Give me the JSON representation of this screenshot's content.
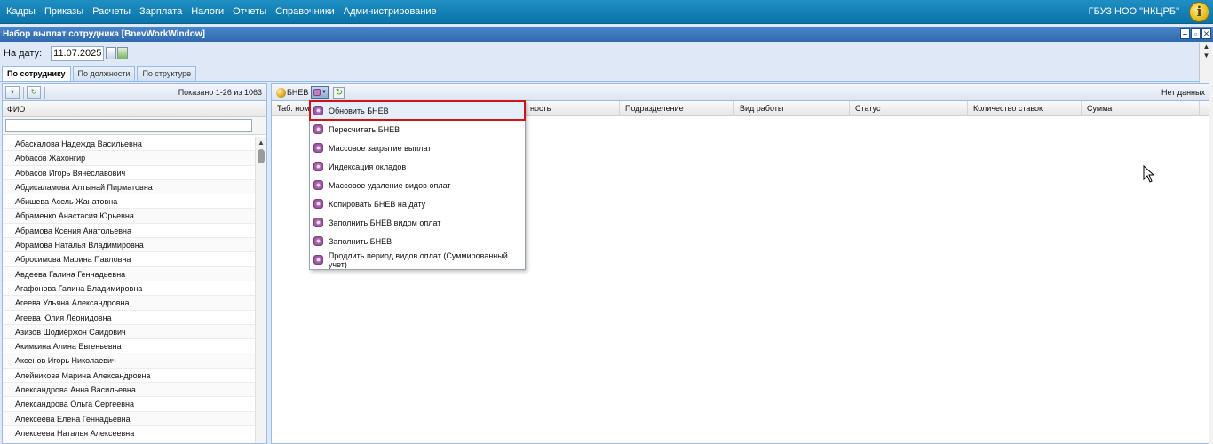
{
  "topbar": {
    "menu": [
      "Кадры",
      "Приказы",
      "Расчеты",
      "Зарплата",
      "Налоги",
      "Отчеты",
      "Справочники",
      "Администрирование"
    ],
    "org": "ГБУЗ НОО \"НКЦРБ\"",
    "info_glyph": "i"
  },
  "window": {
    "title": "Набор выплат сотрудника [BnevWorkWindow]",
    "buttons": [
      "–",
      "▫",
      "✕"
    ]
  },
  "date": {
    "label": "На дату:",
    "value": "11.07.2025"
  },
  "tabs": [
    "По сотруднику",
    "По должности",
    "По структуре"
  ],
  "left": {
    "shown": "Показано 1-26 из 1063",
    "column": "ФИО",
    "employees": [
      "Абаскалова Надежда Васильевна",
      "Аббасов Жахонгир",
      "Аббасов Игорь Вячеславович",
      "Абдисаламова Алтынай Пирматовна",
      "Абишева Асель Жанатовна",
      "Абраменко Анастасия Юрьевна",
      "Абрамова Ксения Анатольевна",
      "Абрамова Наталья Владимировна",
      "Абросимова Марина Павловна",
      "Авдеева Галина Геннадьевна",
      "Агафонова Галина Владимировна",
      "Агеева Ульяна Александровна",
      "Агеева Юлия Леонидовна",
      "Азизов Шодиёржон Саидович",
      "Акимкина Алина Евгеньевна",
      "Аксенов Игорь Николаевич",
      "Алейникова Марина Александровна",
      "Александрова Анна Васильевна",
      "Александрова Ольга Сергеевна",
      "Алексеева Елена Геннадьевна",
      "Алексеева Наталья Алексеевна"
    ]
  },
  "right": {
    "bnev_label": "БНЕВ",
    "nodata": "Нет данных",
    "columns": [
      "Таб. ном",
      "ность",
      "Подразделение",
      "Вид работы",
      "Статус",
      "Количество ставок",
      "Сумма"
    ]
  },
  "dropdown": {
    "items": [
      "Обновить БНЕВ",
      "Пересчитать БНЕВ",
      "Массовое закрытие выплат",
      "Индексация окладов",
      "Массовое удаление видов оплат",
      "Копировать БНЕВ на дату",
      "Заполнить БНЕВ видом оплат",
      "Заполнить БНЕВ",
      "Продлить период видов оплат (Суммированный учет)"
    ],
    "selected_index": 0
  },
  "colors": {
    "topbar": "#0b73a8",
    "window_header": "#2f6aae",
    "highlight_border": "#d0141a"
  }
}
